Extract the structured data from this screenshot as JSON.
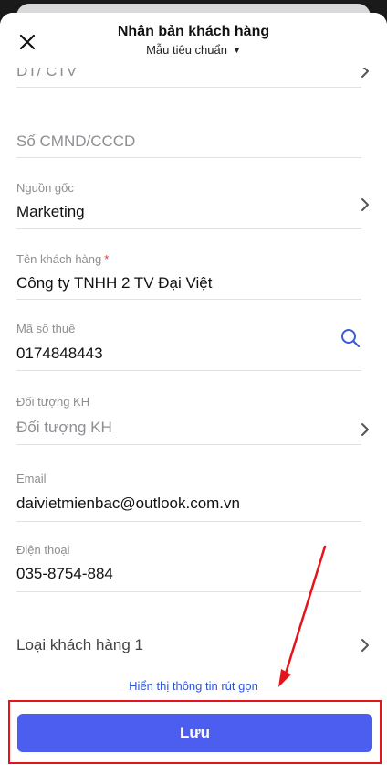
{
  "header": {
    "title": "Nhân bản khách hàng",
    "subtitle": "Mẫu tiêu chuẩn"
  },
  "fields": {
    "partial_top": {
      "value": "DT/ CTV"
    },
    "id_number": {
      "placeholder": "Số CMND/CCCD"
    },
    "source": {
      "label": "Nguồn gốc",
      "value": "Marketing"
    },
    "customer_name": {
      "label": "Tên khách hàng",
      "required_mark": "*",
      "value": "Công ty TNHH 2 TV Đại Việt"
    },
    "tax_code": {
      "label": "Mã số thuế",
      "value": "0174848443"
    },
    "customer_target": {
      "label": "Đối tượng KH",
      "placeholder": "Đối tượng KH"
    },
    "email": {
      "label": "Email",
      "value": "daivietmienbac@outlook.com.vn"
    },
    "phone": {
      "label": "Điện thoại",
      "value": "035-8754-884"
    },
    "customer_type": {
      "placeholder": "Loại khách hàng 1"
    }
  },
  "footer": {
    "summary_link": "Hiển thị thông tin rút gọn",
    "save_label": "Lưu"
  },
  "colors": {
    "accent": "#4b5ef0",
    "link": "#2f55d4",
    "annotation": "#e5141b",
    "required": "#e53935"
  }
}
